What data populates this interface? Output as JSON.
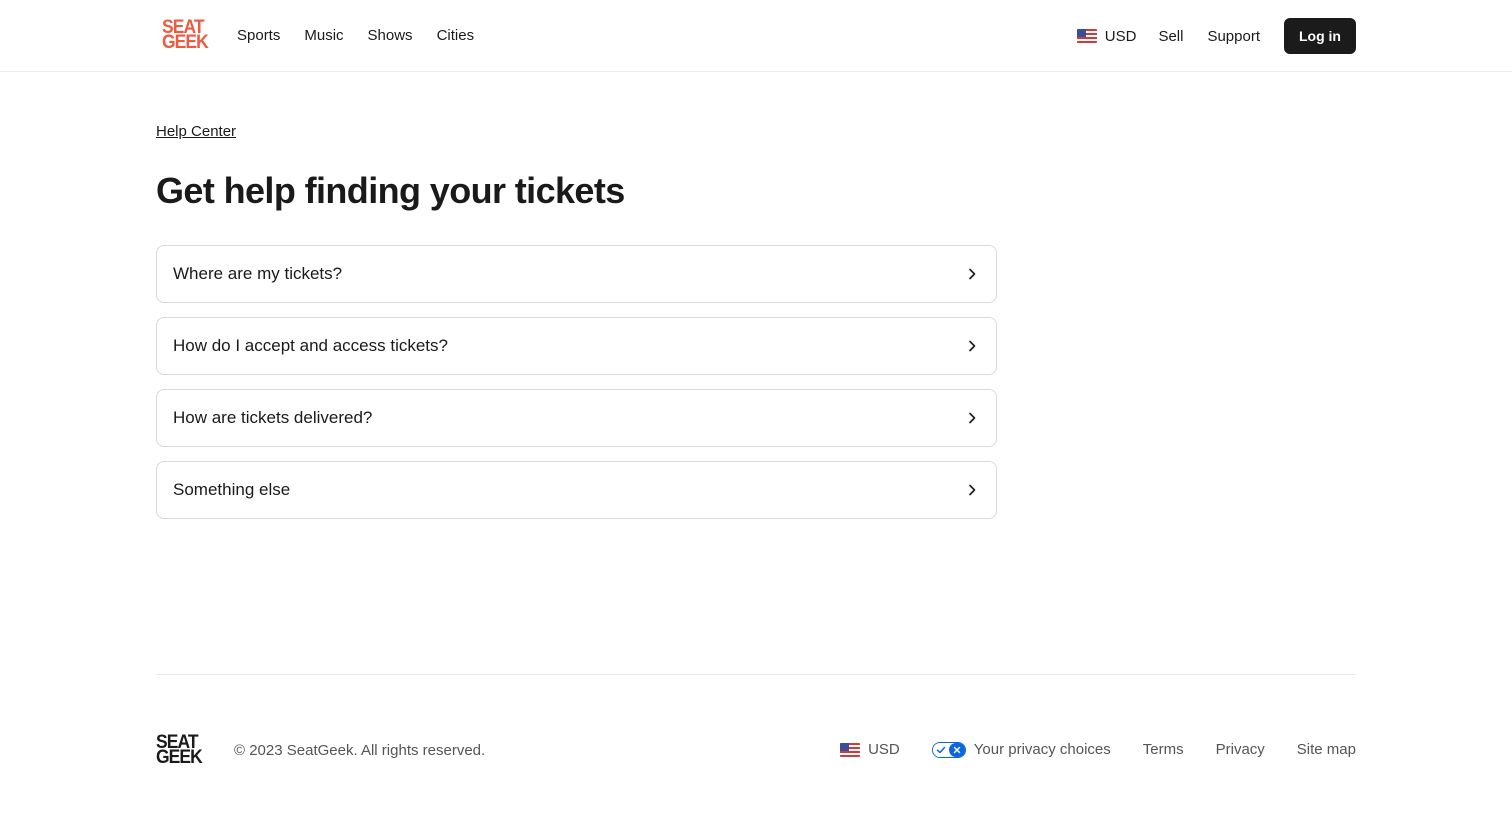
{
  "header": {
    "logo_line1": "SEAT",
    "logo_line2": "GEEK",
    "nav": [
      "Sports",
      "Music",
      "Shows",
      "Cities"
    ],
    "currency": "USD",
    "currency_icon": "us-flag-icon",
    "sell_label": "Sell",
    "support_label": "Support",
    "login_label": "Log in"
  },
  "main": {
    "breadcrumb": "Help Center",
    "title": "Get help finding your tickets",
    "faqs": [
      "Where are my tickets?",
      "How do I accept and access tickets?",
      "How are tickets delivered?",
      "Something else"
    ],
    "faq_icon": "chevron-right-icon"
  },
  "footer": {
    "logo_line1": "SEAT",
    "logo_line2": "GEEK",
    "copyright": "© 2023 SeatGeek. All rights reserved.",
    "currency": "USD",
    "privacy_label": "Your privacy choices",
    "privacy_icon": "privacy-choices-toggle-icon",
    "terms_label": "Terms",
    "privacy_link": "Privacy",
    "sitemap_label": "Site map"
  },
  "colors": {
    "brand": "#ee5a40",
    "login_bg": "#1b1b1b",
    "privacy_blue": "#0a66e0"
  }
}
